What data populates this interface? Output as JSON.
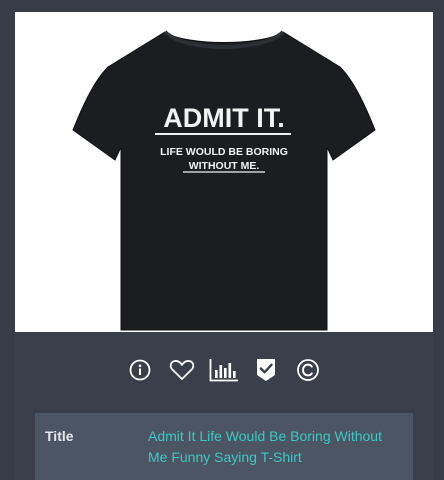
{
  "product": {
    "shirt_headline": "ADMIT IT.",
    "shirt_tagline_line1": "LIFE WOULD BE BORING",
    "shirt_tagline_line2": "WITHOUT ME."
  },
  "toolbar": {
    "icons": [
      "info-icon",
      "heart-icon",
      "bar-chart-icon",
      "badge-check-icon",
      "copyright-icon"
    ]
  },
  "details": {
    "title_label": "Title",
    "title_value": "Admit It Life Would Be Boring Without Me Funny Saying T-Shirt"
  },
  "colors": {
    "accent": "#3cc9c2",
    "panel": "#4c5563",
    "background": "#383c47",
    "icon": "#ffffff"
  }
}
